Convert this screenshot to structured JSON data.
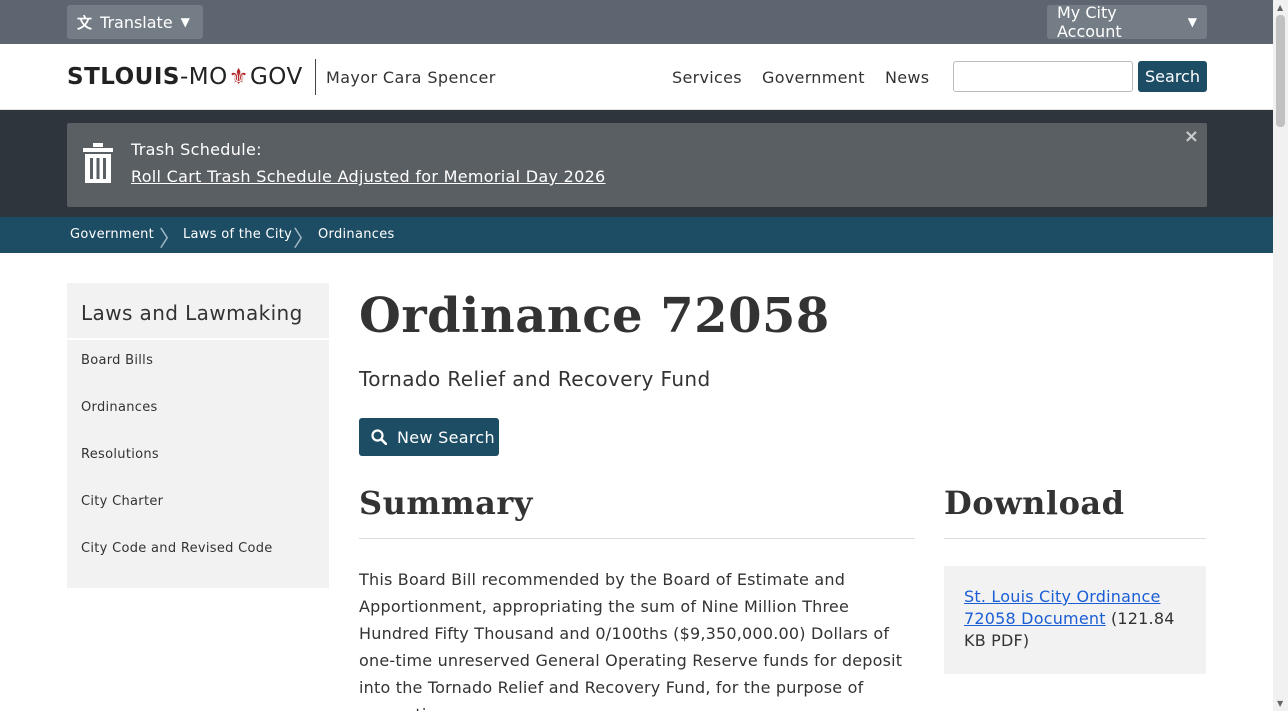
{
  "topbar": {
    "translate_label": "Translate",
    "account_label": "My City Account"
  },
  "header": {
    "logo_stlouis": "STLOUIS",
    "logo_dash": "-MO",
    "logo_gov": "GOV",
    "mayor": "Mayor Cara Spencer",
    "nav": [
      "Services",
      "Government",
      "News"
    ],
    "search_value": "",
    "search_button": "Search"
  },
  "alert": {
    "title": "Trash Schedule:",
    "link": "Roll Cart Trash Schedule Adjusted for Memorial Day 2026",
    "close": "×"
  },
  "breadcrumb": [
    "Government",
    "Laws of the City",
    "Ordinances"
  ],
  "sidebar": {
    "title": "Laws and Lawmaking",
    "items": [
      "Board Bills",
      "Ordinances",
      "Resolutions",
      "City Charter",
      "City Code and Revised Code"
    ]
  },
  "main": {
    "title": "Ordinance 72058",
    "subtitle": "Tornado Relief and Recovery Fund",
    "new_search": "New Search",
    "summary_heading": "Summary",
    "summary_text": "This Board Bill recommended by the Board of Estimate and Apportionment, appropriating the sum of Nine Million Three Hundred Fifty Thousand and 0/100ths ($9,350,000.00) Dollars of one-time unreserved General Operating Reserve funds for deposit into the Tornado Relief and Recovery Fund, for the purpose of supporting",
    "download_heading": "Download",
    "download_link": "St. Louis City Ordinance 72058 Document",
    "download_size": " (121.84 KB PDF)"
  },
  "colors": {
    "topbar": "#5d6670",
    "brand_blue": "#1d4c65",
    "alert_band": "#2e353c",
    "alert_box": "#5a5f64",
    "fleur": "#b02a2a",
    "link": "#1a5ed6"
  }
}
